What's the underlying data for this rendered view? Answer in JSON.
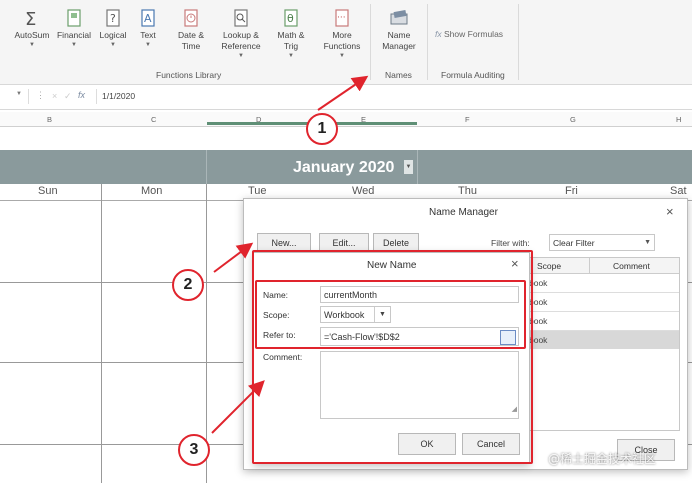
{
  "ribbon": {
    "buttons": [
      {
        "label_lines": [
          "AutoSum"
        ],
        "icon": "sigma-icon"
      },
      {
        "label_lines": [
          "Financial"
        ],
        "icon": "financial-book-icon"
      },
      {
        "label_lines": [
          "Logical"
        ],
        "icon": "logical-question-icon"
      },
      {
        "label_lines": [
          "Text"
        ],
        "icon": "text-a-icon"
      },
      {
        "label_lines": [
          "Date &",
          "Time"
        ],
        "icon": "clock-icon"
      },
      {
        "label_lines": [
          "Lookup &",
          "Reference"
        ],
        "icon": "magnifier-icon"
      },
      {
        "label_lines": [
          "Math &",
          "Trig"
        ],
        "icon": "theta-icon"
      },
      {
        "label_lines": [
          "More",
          "Functions"
        ],
        "icon": "more-dots-icon"
      },
      {
        "label_lines": [
          "Name",
          "Manager"
        ],
        "icon": "name-manager-icon"
      }
    ],
    "group_functions_library": "Functions Library",
    "group_names": "Names",
    "group_formula_auditing": "Formula Auditing",
    "show_formulas": "Show Formulas"
  },
  "formula_bar": {
    "fx": "fx",
    "value": "1/1/2020"
  },
  "columns": [
    "B",
    "C",
    "D",
    "E",
    "F",
    "G",
    "H"
  ],
  "calendar": {
    "month": "January 2020",
    "days": [
      "Sun",
      "Mon",
      "Tue",
      "Wed",
      "Thu",
      "Fri",
      "Sat"
    ]
  },
  "name_manager": {
    "title": "Name Manager",
    "new_label": "New...",
    "edit_label": "Edit...",
    "delete_label": "Delete",
    "filter_label": "Filter with:",
    "filter_value": "Clear Filter",
    "col_scope": "Scope",
    "col_comment": "Comment",
    "scope_cells": [
      "book",
      "book",
      "book",
      "book"
    ],
    "close_label": "Close"
  },
  "new_name": {
    "title": "New Name",
    "name_label": "Name:",
    "name_value": "currentMonth",
    "scope_label": "Scope:",
    "scope_value": "Workbook",
    "refer_label": "Refer to:",
    "refer_value": "='Cash-Flow'!$D$2",
    "comment_label": "Comment:",
    "ok_label": "OK",
    "cancel_label": "Cancel"
  },
  "annotations": [
    "1",
    "2",
    "3"
  ],
  "watermark": "@稀土掘金技术社区",
  "colors": {
    "accent_red": "#e0242d",
    "month_bar": "#8a9a9c"
  }
}
